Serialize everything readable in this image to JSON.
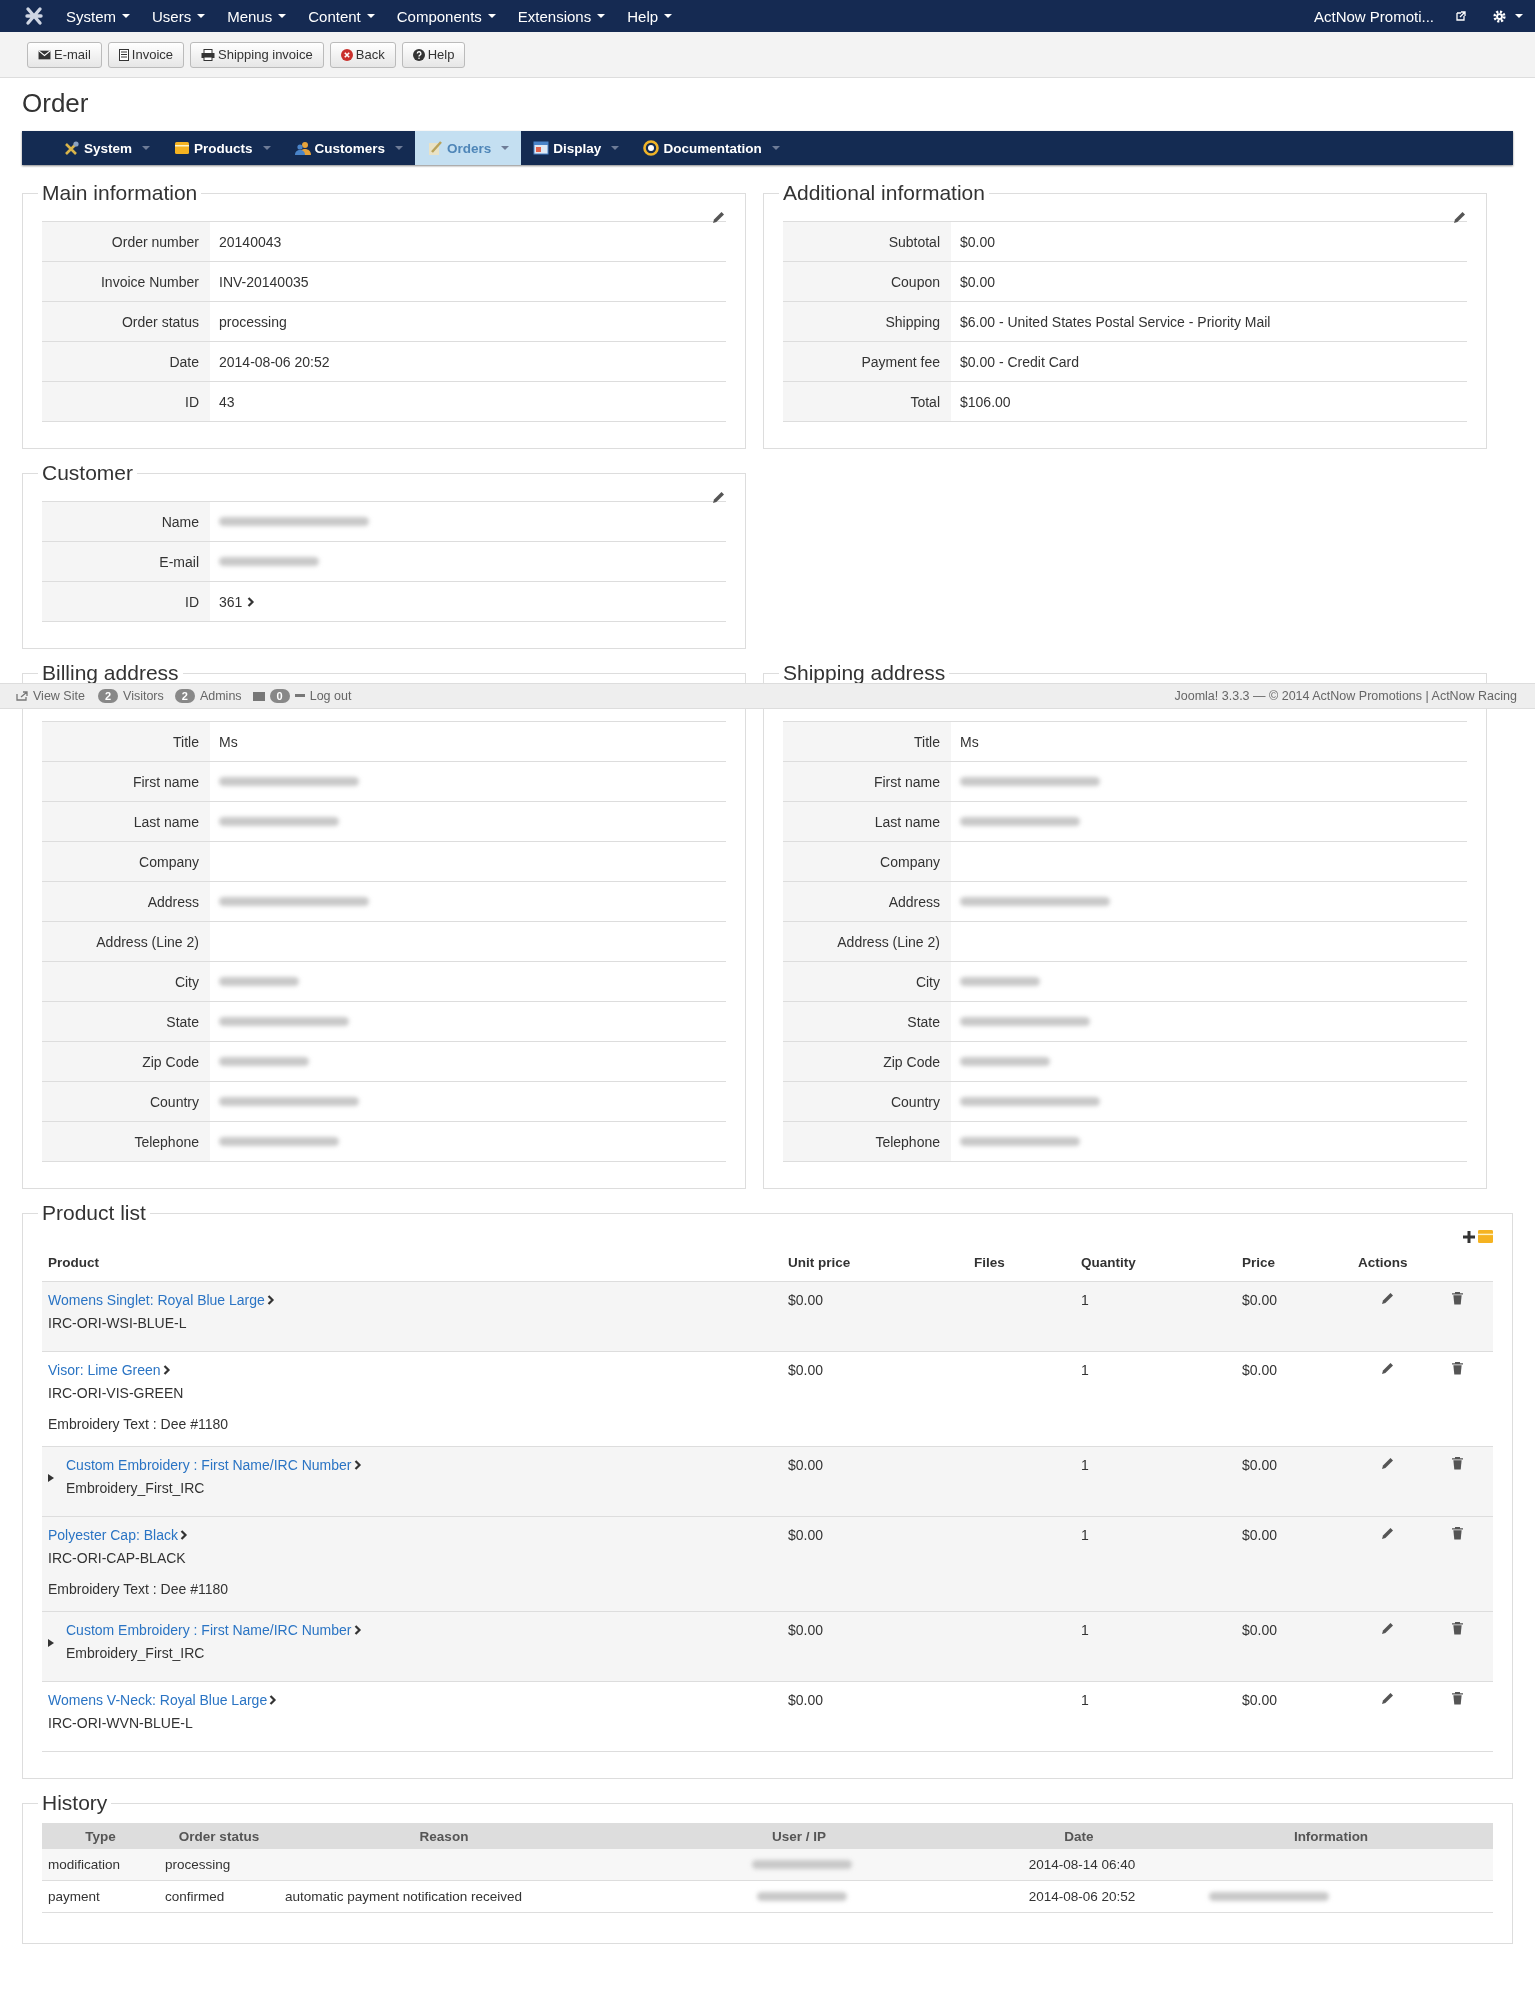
{
  "top_menu": {
    "items": [
      {
        "label": "System"
      },
      {
        "label": "Users"
      },
      {
        "label": "Menus"
      },
      {
        "label": "Content"
      },
      {
        "label": "Components"
      },
      {
        "label": "Extensions"
      },
      {
        "label": "Help"
      }
    ],
    "site_link": "ActNow Promoti..."
  },
  "toolbar": {
    "buttons": [
      {
        "label": "E-mail",
        "kind": "mail"
      },
      {
        "label": "Invoice",
        "kind": "invoice"
      },
      {
        "label": "Shipping invoice",
        "kind": "shipping"
      },
      {
        "label": "Back",
        "kind": "back"
      },
      {
        "label": "Help",
        "kind": "help"
      }
    ]
  },
  "page_title": "Order",
  "submenu": [
    {
      "label": "System",
      "kind": "tools",
      "selected": false
    },
    {
      "label": "Products",
      "kind": "folder",
      "selected": false
    },
    {
      "label": "Customers",
      "kind": "people",
      "selected": false
    },
    {
      "label": "Orders",
      "kind": "orders",
      "selected": true
    },
    {
      "label": "Display",
      "kind": "display",
      "selected": false
    },
    {
      "label": "Documentation",
      "kind": "docs",
      "selected": false
    }
  ],
  "main_information": {
    "title": "Main information",
    "rows": [
      {
        "label": "Order number",
        "value": "20140043"
      },
      {
        "label": "Invoice Number",
        "value": "INV-20140035"
      },
      {
        "label": "Order status",
        "value": "processing"
      },
      {
        "label": "Date",
        "value": "2014-08-06 20:52"
      },
      {
        "label": "ID",
        "value": "43"
      }
    ]
  },
  "additional_information": {
    "title": "Additional information",
    "rows": [
      {
        "label": "Subtotal",
        "value": "$0.00"
      },
      {
        "label": "Coupon",
        "value": "$0.00"
      },
      {
        "label": "Shipping",
        "value": "$6.00 - United States Postal Service - Priority Mail"
      },
      {
        "label": "Payment fee",
        "value": "$0.00 - Credit Card"
      },
      {
        "label": "Total",
        "value": "$106.00"
      }
    ]
  },
  "customer": {
    "title": "Customer",
    "rows": [
      {
        "label": "Name",
        "blurred": true
      },
      {
        "label": "E-mail",
        "blurred": true
      },
      {
        "label": "ID",
        "value": "361",
        "link": true
      }
    ]
  },
  "billing_address": {
    "title": "Billing address",
    "rows": [
      {
        "label": "Title",
        "value": "Ms"
      },
      {
        "label": "First name",
        "blurred": true
      },
      {
        "label": "Last name",
        "blurred": true
      },
      {
        "label": "Company",
        "blurred": false
      },
      {
        "label": "Address",
        "blurred": true
      },
      {
        "label": "Address (Line 2)",
        "blurred": false
      },
      {
        "label": "City",
        "blurred": true
      },
      {
        "label": "State",
        "blurred": true
      },
      {
        "label": "Zip Code",
        "blurred": true
      },
      {
        "label": "Country",
        "blurred": true
      },
      {
        "label": "Telephone",
        "blurred": true
      }
    ]
  },
  "shipping_address": {
    "title": "Shipping address",
    "rows": [
      {
        "label": "Title",
        "value": "Ms"
      },
      {
        "label": "First name",
        "blurred": true
      },
      {
        "label": "Last name",
        "blurred": true
      },
      {
        "label": "Company",
        "blurred": false
      },
      {
        "label": "Address",
        "blurred": true
      },
      {
        "label": "Address (Line 2)",
        "blurred": false
      },
      {
        "label": "City",
        "blurred": true
      },
      {
        "label": "State",
        "blurred": true
      },
      {
        "label": "Zip Code",
        "blurred": true
      },
      {
        "label": "Country",
        "blurred": true
      },
      {
        "label": "Telephone",
        "blurred": true
      }
    ]
  },
  "status_bar": {
    "view_site": "View Site",
    "visitors_count": "2",
    "visitors": "Visitors",
    "admins_count": "2",
    "admins": "Admins",
    "messages_count": "0",
    "logout": "Log out",
    "credits": "Joomla! 3.3.3  —  © 2014 ActNow Promotions | ActNow Racing"
  },
  "product_list": {
    "title": "Product list",
    "columns": [
      "Product",
      "Unit price",
      "Files",
      "Quantity",
      "Price",
      "Actions"
    ],
    "items": [
      {
        "name": "Womens Singlet: Royal Blue Large",
        "sku": "IRC-ORI-WSI-BLUE-L",
        "unit_price": "$0.00",
        "quantity": "1",
        "price": "$0.00"
      },
      {
        "name": "Visor: Lime Green",
        "sku": "IRC-ORI-VIS-GREEN",
        "note": "Embroidery Text : Dee #1180",
        "unit_price": "$0.00",
        "quantity": "1",
        "price": "$0.00",
        "children": [
          {
            "name": "Custom Embroidery : First Name/IRC Number",
            "sku": "Embroidery_First_IRC",
            "unit_price": "$0.00",
            "quantity": "1",
            "price": "$0.00"
          }
        ]
      },
      {
        "name": "Polyester Cap: Black",
        "sku": "IRC-ORI-CAP-BLACK",
        "note": "Embroidery Text : Dee #1180",
        "unit_price": "$0.00",
        "quantity": "1",
        "price": "$0.00",
        "children": [
          {
            "name": "Custom Embroidery : First Name/IRC Number",
            "sku": "Embroidery_First_IRC",
            "unit_price": "$0.00",
            "quantity": "1",
            "price": "$0.00"
          }
        ]
      },
      {
        "name": "Womens V-Neck: Royal Blue Large",
        "sku": "IRC-ORI-WVN-BLUE-L",
        "unit_price": "$0.00",
        "quantity": "1",
        "price": "$0.00"
      }
    ]
  },
  "history": {
    "title": "History",
    "columns": [
      "Type",
      "Order status",
      "Reason",
      "User / IP",
      "Date",
      "Information"
    ],
    "rows": [
      {
        "cells": [
          {
            "text": "modification"
          },
          {
            "text": "processing"
          },
          {
            "blurred": false
          },
          {
            "blurred": true
          },
          {
            "text": "2014-08-14 06:40"
          },
          {
            "blurred": false
          }
        ]
      },
      {
        "cells": [
          {
            "text": "payment"
          },
          {
            "text": "confirmed"
          },
          {
            "text": "automatic payment notification received"
          },
          {
            "blurred": true
          },
          {
            "text": "2014-08-06 20:52"
          },
          {
            "blurred": true
          }
        ]
      }
    ]
  }
}
